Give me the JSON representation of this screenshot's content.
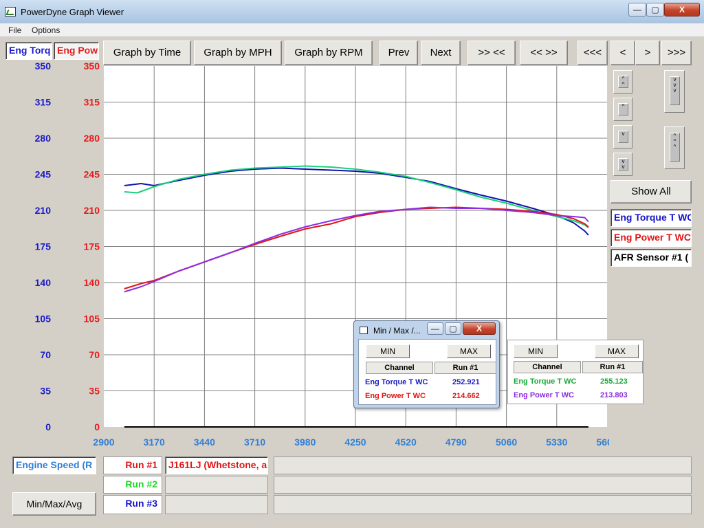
{
  "window": {
    "title": "PowerDyne Graph Viewer",
    "controls": {
      "minimize": "—",
      "restore": "▢",
      "close": "X"
    }
  },
  "menu": {
    "items": [
      "File",
      "Options"
    ]
  },
  "axis_tabs": {
    "left": "Eng Torq",
    "right": "Eng Pow"
  },
  "toolbar": {
    "graph_by_time": "Graph by Time",
    "graph_by_mph": "Graph by MPH",
    "graph_by_rpm": "Graph by RPM",
    "prev": "Prev",
    "next": "Next",
    "zoom_in": ">> <<",
    "zoom_out": "<< >>",
    "first": "<<<",
    "step_back": "<",
    "step_fwd": ">",
    "last": ">>>"
  },
  "side": {
    "show_all": "Show All",
    "channels": [
      {
        "label": "Engine Torque T WC",
        "visible": "Eng Torque T WC",
        "color": "#1414c8"
      },
      {
        "label": "Engine Power T WC",
        "visible": "Eng Power T WC",
        "color": "#e01414"
      },
      {
        "label": "AFR Sensor #1",
        "visible": "AFR Sensor #1 (",
        "color": "#000000"
      }
    ]
  },
  "colors": {
    "torque_axis": "#1a1acb",
    "power_axis": "#e51c1c",
    "x_axis": "#2f7fd6",
    "run1": "#e01414",
    "run2": "#1ed81e",
    "run3": "#1414c8"
  },
  "chart_data": {
    "type": "line",
    "xlabel": "Engine Speed (R",
    "x_ticks": [
      2900,
      3170,
      3440,
      3710,
      3980,
      4250,
      4520,
      4790,
      5060,
      5330,
      5600
    ],
    "xlim": [
      2900,
      5600
    ],
    "y_left_ticks": [
      0,
      35,
      70,
      105,
      140,
      175,
      210,
      245,
      280,
      315,
      350
    ],
    "y_right_ticks": [
      0,
      35,
      70,
      105,
      140,
      175,
      210,
      245,
      280,
      315,
      350
    ],
    "ylim": [
      0,
      350
    ],
    "grid": true,
    "series": [
      {
        "name": "Eng Torque T WC",
        "run": "Run #1",
        "color": "#1010b0",
        "x": [
          3010,
          3100,
          3170,
          3300,
          3440,
          3580,
          3710,
          3850,
          3980,
          4120,
          4250,
          4380,
          4520,
          4650,
          4790,
          4920,
          5060,
          5200,
          5330,
          5420,
          5480,
          5500
        ],
        "y": [
          234,
          236,
          234,
          239,
          244,
          248,
          250,
          251,
          250,
          249,
          248,
          246,
          242,
          238,
          231,
          225,
          219,
          212,
          205,
          198,
          190,
          186
        ]
      },
      {
        "name": "Eng Torque T WC",
        "run": "Run #2",
        "color": "#19d07a",
        "x": [
          3010,
          3080,
          3170,
          3300,
          3440,
          3580,
          3710,
          3850,
          3980,
          4120,
          4250,
          4380,
          4520,
          4650,
          4790,
          4920,
          5060,
          5200,
          5330,
          5420,
          5480,
          5500
        ],
        "y": [
          228,
          227,
          233,
          240,
          245,
          249,
          251,
          252,
          253,
          252,
          250,
          247,
          243,
          237,
          230,
          223,
          217,
          210,
          204,
          200,
          196,
          193
        ]
      },
      {
        "name": "Eng Power T WC",
        "run": "Run #1",
        "color": "#e01414",
        "x": [
          3010,
          3100,
          3170,
          3300,
          3440,
          3580,
          3710,
          3850,
          3980,
          4120,
          4250,
          4380,
          4520,
          4650,
          4790,
          4920,
          5060,
          5200,
          5330,
          5420,
          5480,
          5500
        ],
        "y": [
          134,
          139,
          142,
          151,
          160,
          169,
          177,
          185,
          192,
          197,
          204,
          208,
          211,
          212,
          213,
          212,
          211,
          209,
          206,
          202,
          197,
          194
        ]
      },
      {
        "name": "Eng Power T WC",
        "run": "Run #2",
        "color": "#8e2ee0",
        "x": [
          3010,
          3100,
          3170,
          3300,
          3440,
          3580,
          3710,
          3850,
          3980,
          4120,
          4250,
          4380,
          4520,
          4650,
          4790,
          4920,
          5060,
          5200,
          5330,
          5420,
          5480,
          5500
        ],
        "y": [
          131,
          136,
          141,
          151,
          160,
          169,
          178,
          187,
          194,
          200,
          205,
          209,
          211,
          213,
          212,
          212,
          210,
          208,
          205,
          204,
          203,
          199
        ]
      }
    ]
  },
  "runs": [
    {
      "label": "Run #1",
      "color": "#e01414",
      "name": "J161LJ (Whetstone, a",
      "name_color": "#e01414"
    },
    {
      "label": "Run #2",
      "color": "#1ed81e",
      "name": "",
      "name_color": "#1ed81e"
    },
    {
      "label": "Run #3",
      "color": "#1414c8",
      "name": "",
      "name_color": "#1414c8"
    }
  ],
  "bottom": {
    "min_max_avg": "Min/Max/Avg"
  },
  "minmax": {
    "title": "Min / Max /...",
    "min_label": "MIN",
    "max_label": "MAX",
    "channel_header": "Channel",
    "run_header": "Run #1",
    "panel1": [
      {
        "channel": "Eng Torque T WC",
        "value": "252.921",
        "color": "#1c1cc0"
      },
      {
        "channel": "Eng Power T WC",
        "value": "214.662",
        "color": "#e01414"
      }
    ],
    "panel2": [
      {
        "channel": "Eng Torque T WC",
        "value": "255.123",
        "color": "#1aa83a"
      },
      {
        "channel": "Eng Power T WC",
        "value": "213.803",
        "color": "#8a2be2"
      }
    ]
  }
}
